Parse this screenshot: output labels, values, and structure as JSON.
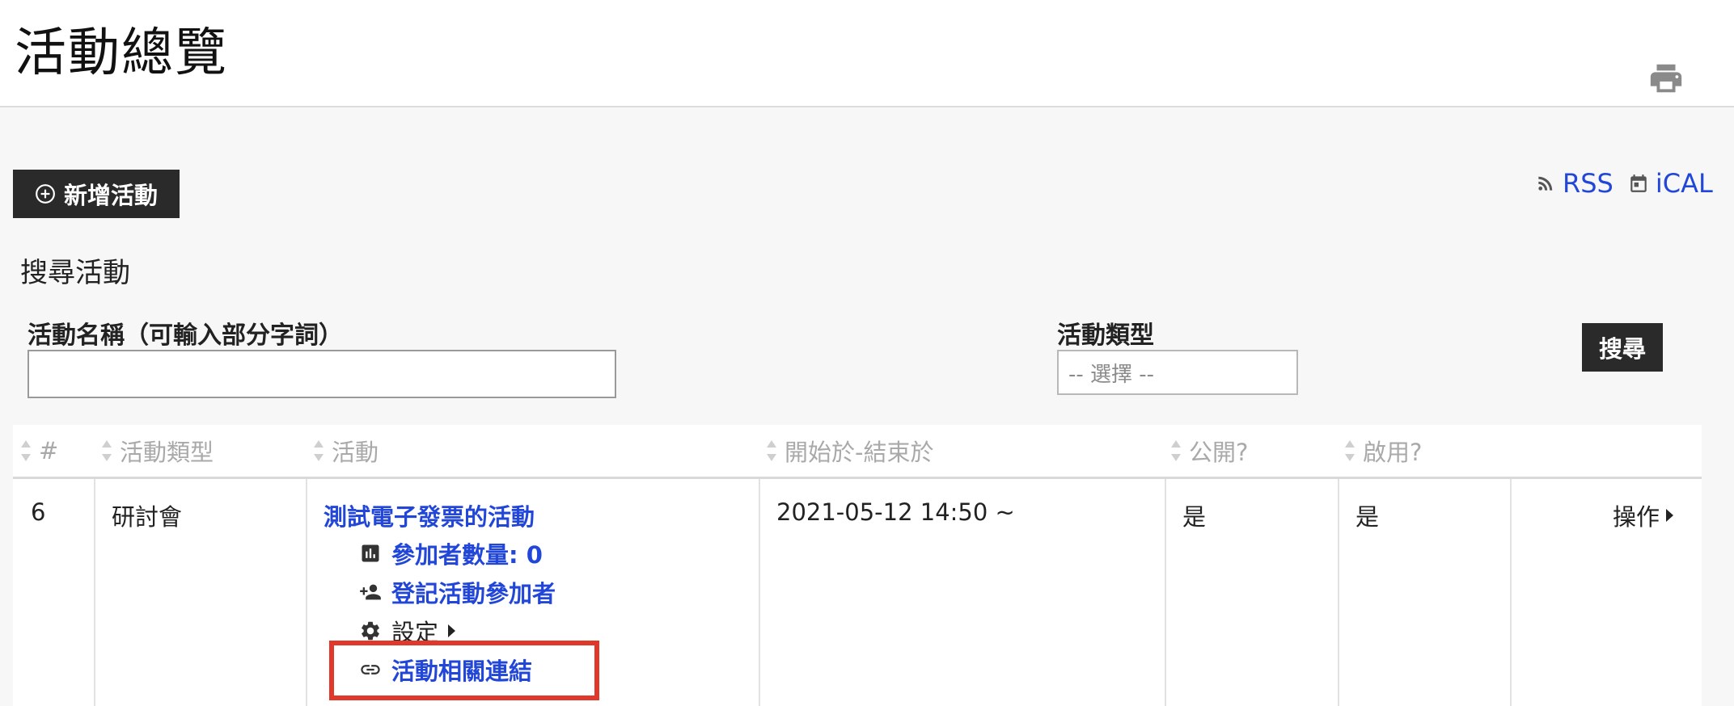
{
  "header": {
    "title": "活動總覽",
    "print_icon": "printer-icon"
  },
  "toolbar": {
    "new_event_label": "新增活動",
    "new_event_icon": "plus-circle-icon"
  },
  "feeds": [
    {
      "label": "RSS",
      "icon": "rss-icon"
    },
    {
      "label": "iCAL",
      "icon": "calendar-icon"
    }
  ],
  "search": {
    "title": "搜尋活動",
    "name_label": "活動名稱（可輸入部分字詞）",
    "name_value": "",
    "type_label": "活動類型",
    "type_selected": "-- 選擇 --",
    "button_label": "搜尋"
  },
  "table": {
    "columns": [
      "#",
      "活動類型",
      "活動",
      "開始於-結束於",
      "公開?",
      "啟用?"
    ],
    "rows": [
      {
        "id": "6",
        "type": "研討會",
        "event": "測試電子發票的活動",
        "participants_label": "參加者數量: 0",
        "register_label": "登記活動參加者",
        "settings_label": "設定",
        "links_label": "活動相關連結",
        "datetime": "2021-05-12 14:50 ~",
        "public": "是",
        "enabled": "是",
        "actions_label": "操作"
      }
    ]
  },
  "colors": {
    "accent": "#2247d8",
    "button_dark": "#2a2a2a",
    "highlight": "#e0392b"
  }
}
